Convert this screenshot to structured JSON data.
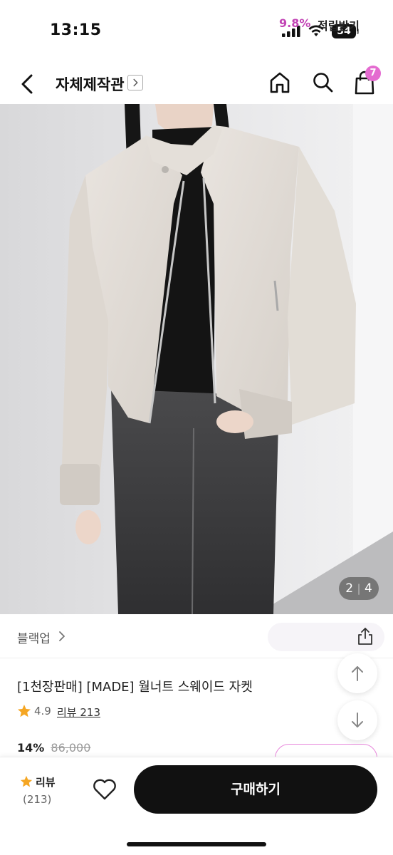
{
  "status_bar": {
    "time": "13:15",
    "battery": "54"
  },
  "nav": {
    "store_name": "자체제작관",
    "cart_count": "7"
  },
  "gallery": {
    "current": "2",
    "total": "4"
  },
  "brand": {
    "name": "블랙업",
    "points_rate": "9.8%",
    "points_label": "적립받기"
  },
  "product": {
    "title": "[1천장판매] [MADE] 월너트 스웨이드 자켓",
    "rating": "4.9",
    "review_link": "리뷰 213",
    "discount": "14%",
    "original_price": "86,000"
  },
  "bottom_bar": {
    "review_label": "리뷰",
    "review_count": "(213)",
    "buy_label": "구매하기"
  },
  "colors": {
    "accent": "#c244b5",
    "badge": "#e46bd0",
    "star": "#f5a623",
    "buy_button": "#111111"
  }
}
